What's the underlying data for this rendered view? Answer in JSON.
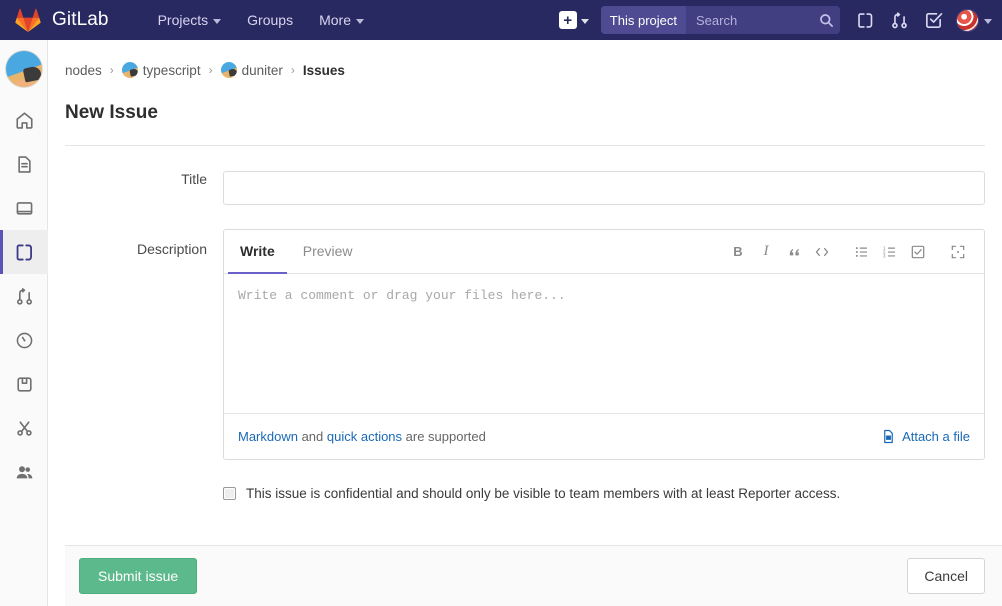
{
  "navbar": {
    "brand": "GitLab",
    "logo_icon": "gitlab-fox-logo",
    "links": [
      {
        "label": "Projects",
        "icon": "chevron-down-icon"
      },
      {
        "label": "Groups",
        "icon": ""
      },
      {
        "label": "More",
        "icon": "chevron-down-icon"
      }
    ],
    "new_button": {
      "label": "+",
      "icon": "plus-icon",
      "caret_icon": "chevron-down-icon"
    },
    "search": {
      "scope_label": "This project",
      "placeholder": "Search",
      "value": "",
      "icon": "search-icon"
    },
    "icons": [
      {
        "name": "issues-icon"
      },
      {
        "name": "merge-request-icon"
      },
      {
        "name": "todos-checkmark-icon"
      }
    ],
    "user": {
      "avatar_icon": "user-avatar",
      "caret_icon": "chevron-down-icon"
    },
    "background_color": "#292961"
  },
  "sidebar": {
    "project_avatar": "project-avatar",
    "items": [
      {
        "name": "home",
        "icon": "home-icon",
        "active": false
      },
      {
        "name": "project-overview",
        "icon": "file-document-icon",
        "active": false
      },
      {
        "name": "repository",
        "icon": "repository-monitor-icon",
        "active": false
      },
      {
        "name": "issues",
        "icon": "issues-icon",
        "active": true
      },
      {
        "name": "merge-requests",
        "icon": "merge-request-icon",
        "active": false
      },
      {
        "name": "ci-cd",
        "icon": "rocket-clock-icon",
        "active": false
      },
      {
        "name": "packages",
        "icon": "package-icon",
        "active": false
      },
      {
        "name": "snippets",
        "icon": "scissors-icon",
        "active": false
      },
      {
        "name": "members",
        "icon": "users-icon",
        "active": false
      }
    ],
    "active_accent_color": "#5b53b5"
  },
  "breadcrumb": {
    "items": [
      {
        "label": "nodes",
        "avatar": false,
        "current": false
      },
      {
        "label": "typescript",
        "avatar": true,
        "current": false
      },
      {
        "label": "duniter",
        "avatar": true,
        "current": false
      },
      {
        "label": "Issues",
        "avatar": false,
        "current": true
      }
    ],
    "separator": "›"
  },
  "page": {
    "title": "New Issue"
  },
  "form": {
    "title_field": {
      "label": "Title",
      "value": "",
      "placeholder": ""
    },
    "description_field": {
      "label": "Description",
      "tabs": [
        {
          "label": "Write",
          "active": true
        },
        {
          "label": "Preview",
          "active": false
        }
      ],
      "toolbar": [
        {
          "name": "bold-icon",
          "glyph": "B"
        },
        {
          "name": "italic-icon",
          "glyph": "I"
        },
        {
          "name": "quote-icon",
          "glyph": "”"
        },
        {
          "name": "code-icon",
          "glyph": "</>"
        },
        {
          "name": "bullet-list-icon",
          "glyph": ""
        },
        {
          "name": "numbered-list-icon",
          "glyph": ""
        },
        {
          "name": "task-list-icon",
          "glyph": ""
        },
        {
          "name": "fullscreen-icon",
          "glyph": ""
        }
      ],
      "placeholder": "Write a comment or drag your files here...",
      "value": "",
      "footer": {
        "markdown_link": "Markdown",
        "and_text": " and ",
        "quick_actions_link": "quick actions",
        "supported_text": " are supported",
        "attach_label": "Attach a file",
        "attach_icon": "attach-image-icon"
      },
      "active_tab_color": "#6b5fc9"
    },
    "confidential": {
      "checked": false,
      "label": "This issue is confidential and should only be visible to team members with at least Reporter access."
    }
  },
  "actions": {
    "submit_label": "Submit issue",
    "submit_color": "#5cb98b",
    "cancel_label": "Cancel"
  }
}
